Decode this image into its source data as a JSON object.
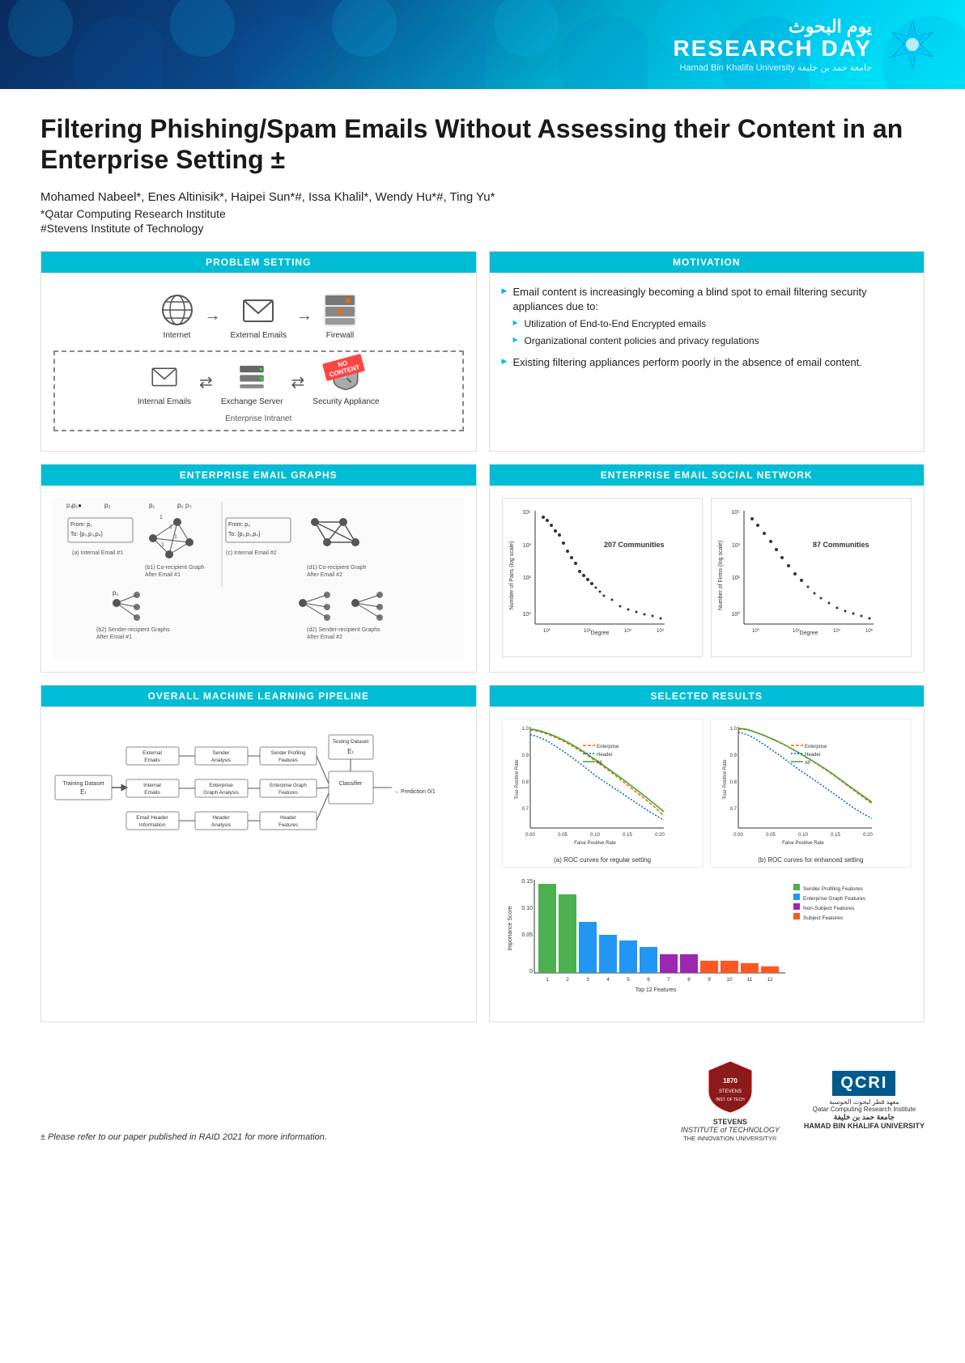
{
  "header": {
    "arabic_text": "يوم البحوث",
    "research_day": "RESEARCH DAY",
    "university": "Hamad Bin Khalifa University  جامعة حمد بن خليفة"
  },
  "paper": {
    "title": "Filtering Phishing/Spam Emails Without Assessing their Content in an Enterprise Setting ±",
    "authors": "Mohamed Nabeel*, Enes Altinisik*, Haipei Sun*#, Issa Khalil*, Wendy Hu*#, Ting Yu*",
    "affiliation1": "*Qatar Computing Research Institute",
    "affiliation2": "#Stevens Institute of Technology"
  },
  "sections": {
    "problem_setting": {
      "header": "PROBLEM SETTING",
      "diagram_labels": {
        "internet": "Internet",
        "external_emails": "External Emails",
        "firewall": "Firewall",
        "internal_emails": "Internal Emails",
        "exchange_server": "Exchange Server",
        "security_appliance": "Security Appliance",
        "enterprise_intranet": "Enterprise Intranet",
        "no_content": "NO CONTENT"
      }
    },
    "motivation": {
      "header": "MOTIVATION",
      "bullet1": "Email content is increasingly becoming a blind spot to email filtering security appliances due to:",
      "sub1": "Utilization of End-to-End Encrypted emails",
      "sub2": "Organizational content policies and privacy regulations",
      "bullet2": "Existing filtering appliances perform poorly in the absence of email content."
    },
    "enterprise_email_graphs": {
      "header": "ENTERPRISE EMAIL GRAPHS"
    },
    "enterprise_email_social": {
      "header": "ENTERPRISE EMAIL SOCIAL NETWORK",
      "communities1": "207 Communities",
      "communities2": "87 Communities"
    },
    "ml_pipeline": {
      "header": "OVERALL MACHINE LEARNING PIPELINE",
      "blocks": {
        "training_dataset": "Training Dataset",
        "email_t": "Eₜ",
        "external_emails": "External Emails",
        "internal_emails": "Internal Emails",
        "email_header": "Email Header Information",
        "sender_analysis": "Sender Analysis",
        "enterprise_graph": "Enterprise Graph Analysis",
        "header_analysis": "Header Analysis",
        "sender_profiling": "Sender Profiling Features",
        "enterprise_graph_features": "Enterprise Graph Features",
        "header_features": "Header Features",
        "classifier": "Classifier",
        "testing_dataset": "Testing Dataset",
        "email_t_test": "Eₜ",
        "prediction": "Prediction 0/1"
      }
    },
    "selected_results": {
      "header": "SELECTED RESULTS",
      "roc_a_title": "(a) ROC curves for regular setting",
      "roc_b_title": "(b) ROC curves for enhanced setting",
      "legend": [
        "Enterprise",
        "Header",
        "All"
      ],
      "y_axis": "True Positive Rate",
      "x_axis": "False Positive Rate",
      "bar_y_axis": "Importance Score",
      "bar_x_axis": "Top 12 Features",
      "bar_legend": [
        "Sender Profiling Features",
        "Enterprise Graph Features",
        "Non-Subject Features",
        "Subject Features"
      ],
      "bar_values": [
        0.16,
        0.13,
        0.08,
        0.06,
        0.05,
        0.04,
        0.03,
        0.03,
        0.02,
        0.02,
        0.015,
        0.01
      ],
      "bar_colors": [
        "#4CAF50",
        "#4CAF50",
        "#2196F3",
        "#2196F3",
        "#2196F3",
        "#2196F3",
        "#9C27B0",
        "#9C27B0",
        "#FF5722",
        "#FF5722",
        "#FF5722",
        "#FF5722"
      ]
    }
  },
  "footer": {
    "footnote": "± Please refer to our paper published in RAID 2021 for more information.",
    "stevens_label": "STEVENS\nINSTITUTE of TECHNOLOGY\nTHE INNOVATION UNIVERSITY®",
    "qcri_label": "QCRI",
    "qcri_arabic": "معهد قطر لبحوث الحوسبة\nQatar Computing Research Institute",
    "hbku": "جامعة حمد بن خليفة\nHAMAD BIN KHALIFA UNIVERSITY"
  }
}
